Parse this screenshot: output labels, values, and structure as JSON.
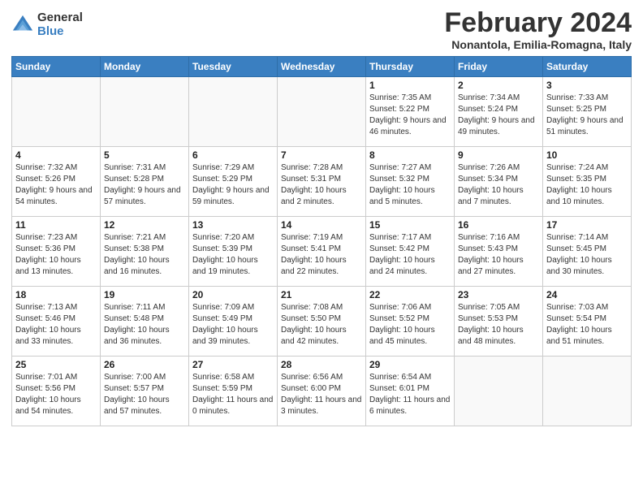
{
  "logo": {
    "general": "General",
    "blue": "Blue"
  },
  "title": "February 2024",
  "location": "Nonantola, Emilia-Romagna, Italy",
  "days_header": [
    "Sunday",
    "Monday",
    "Tuesday",
    "Wednesday",
    "Thursday",
    "Friday",
    "Saturday"
  ],
  "weeks": [
    [
      {
        "day": "",
        "info": ""
      },
      {
        "day": "",
        "info": ""
      },
      {
        "day": "",
        "info": ""
      },
      {
        "day": "",
        "info": ""
      },
      {
        "day": "1",
        "info": "Sunrise: 7:35 AM\nSunset: 5:22 PM\nDaylight: 9 hours\nand 46 minutes."
      },
      {
        "day": "2",
        "info": "Sunrise: 7:34 AM\nSunset: 5:24 PM\nDaylight: 9 hours\nand 49 minutes."
      },
      {
        "day": "3",
        "info": "Sunrise: 7:33 AM\nSunset: 5:25 PM\nDaylight: 9 hours\nand 51 minutes."
      }
    ],
    [
      {
        "day": "4",
        "info": "Sunrise: 7:32 AM\nSunset: 5:26 PM\nDaylight: 9 hours\nand 54 minutes."
      },
      {
        "day": "5",
        "info": "Sunrise: 7:31 AM\nSunset: 5:28 PM\nDaylight: 9 hours\nand 57 minutes."
      },
      {
        "day": "6",
        "info": "Sunrise: 7:29 AM\nSunset: 5:29 PM\nDaylight: 9 hours\nand 59 minutes."
      },
      {
        "day": "7",
        "info": "Sunrise: 7:28 AM\nSunset: 5:31 PM\nDaylight: 10 hours\nand 2 minutes."
      },
      {
        "day": "8",
        "info": "Sunrise: 7:27 AM\nSunset: 5:32 PM\nDaylight: 10 hours\nand 5 minutes."
      },
      {
        "day": "9",
        "info": "Sunrise: 7:26 AM\nSunset: 5:34 PM\nDaylight: 10 hours\nand 7 minutes."
      },
      {
        "day": "10",
        "info": "Sunrise: 7:24 AM\nSunset: 5:35 PM\nDaylight: 10 hours\nand 10 minutes."
      }
    ],
    [
      {
        "day": "11",
        "info": "Sunrise: 7:23 AM\nSunset: 5:36 PM\nDaylight: 10 hours\nand 13 minutes."
      },
      {
        "day": "12",
        "info": "Sunrise: 7:21 AM\nSunset: 5:38 PM\nDaylight: 10 hours\nand 16 minutes."
      },
      {
        "day": "13",
        "info": "Sunrise: 7:20 AM\nSunset: 5:39 PM\nDaylight: 10 hours\nand 19 minutes."
      },
      {
        "day": "14",
        "info": "Sunrise: 7:19 AM\nSunset: 5:41 PM\nDaylight: 10 hours\nand 22 minutes."
      },
      {
        "day": "15",
        "info": "Sunrise: 7:17 AM\nSunset: 5:42 PM\nDaylight: 10 hours\nand 24 minutes."
      },
      {
        "day": "16",
        "info": "Sunrise: 7:16 AM\nSunset: 5:43 PM\nDaylight: 10 hours\nand 27 minutes."
      },
      {
        "day": "17",
        "info": "Sunrise: 7:14 AM\nSunset: 5:45 PM\nDaylight: 10 hours\nand 30 minutes."
      }
    ],
    [
      {
        "day": "18",
        "info": "Sunrise: 7:13 AM\nSunset: 5:46 PM\nDaylight: 10 hours\nand 33 minutes."
      },
      {
        "day": "19",
        "info": "Sunrise: 7:11 AM\nSunset: 5:48 PM\nDaylight: 10 hours\nand 36 minutes."
      },
      {
        "day": "20",
        "info": "Sunrise: 7:09 AM\nSunset: 5:49 PM\nDaylight: 10 hours\nand 39 minutes."
      },
      {
        "day": "21",
        "info": "Sunrise: 7:08 AM\nSunset: 5:50 PM\nDaylight: 10 hours\nand 42 minutes."
      },
      {
        "day": "22",
        "info": "Sunrise: 7:06 AM\nSunset: 5:52 PM\nDaylight: 10 hours\nand 45 minutes."
      },
      {
        "day": "23",
        "info": "Sunrise: 7:05 AM\nSunset: 5:53 PM\nDaylight: 10 hours\nand 48 minutes."
      },
      {
        "day": "24",
        "info": "Sunrise: 7:03 AM\nSunset: 5:54 PM\nDaylight: 10 hours\nand 51 minutes."
      }
    ],
    [
      {
        "day": "25",
        "info": "Sunrise: 7:01 AM\nSunset: 5:56 PM\nDaylight: 10 hours\nand 54 minutes."
      },
      {
        "day": "26",
        "info": "Sunrise: 7:00 AM\nSunset: 5:57 PM\nDaylight: 10 hours\nand 57 minutes."
      },
      {
        "day": "27",
        "info": "Sunrise: 6:58 AM\nSunset: 5:59 PM\nDaylight: 11 hours\nand 0 minutes."
      },
      {
        "day": "28",
        "info": "Sunrise: 6:56 AM\nSunset: 6:00 PM\nDaylight: 11 hours\nand 3 minutes."
      },
      {
        "day": "29",
        "info": "Sunrise: 6:54 AM\nSunset: 6:01 PM\nDaylight: 11 hours\nand 6 minutes."
      },
      {
        "day": "",
        "info": ""
      },
      {
        "day": "",
        "info": ""
      }
    ]
  ]
}
